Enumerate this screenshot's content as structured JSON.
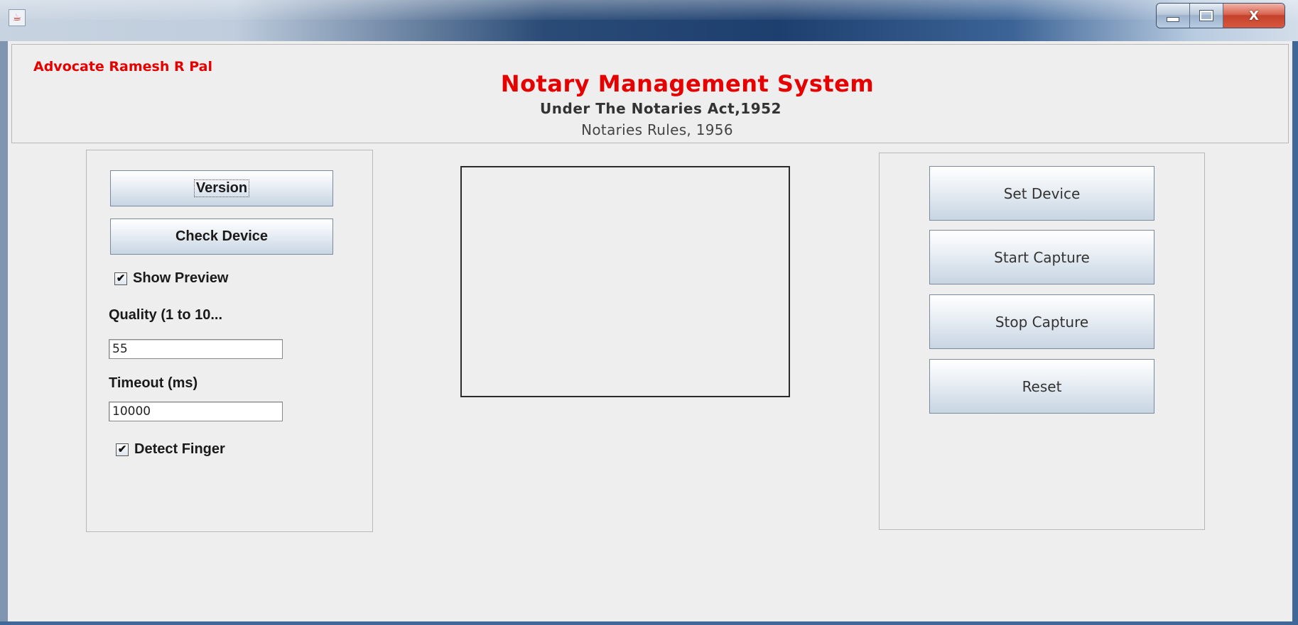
{
  "window": {
    "app_icon": "java-cup-icon",
    "controls": {
      "minimize_icon": "minimize-icon",
      "maximize_icon": "maximize-icon",
      "close_icon": "close-icon",
      "close_glyph": "X"
    }
  },
  "header": {
    "advocate": "Advocate Ramesh R Pal",
    "title": "Notary Management System",
    "subtitle": "Under The Notaries Act,1952",
    "rules": "Notaries Rules, 1956"
  },
  "left_panel": {
    "version_button": "Version",
    "check_device_button": "Check Device",
    "show_preview": {
      "label": "Show Preview",
      "checked": true
    },
    "quality_label": "Quality (1 to 10...",
    "quality_value": "55",
    "timeout_label": "Timeout (ms)",
    "timeout_value": "10000",
    "detect_finger": {
      "label": "Detect Finger",
      "checked": true
    }
  },
  "right_panel": {
    "set_device_button": "Set Device",
    "start_capture_button": "Start Capture",
    "stop_capture_button": "Stop Capture",
    "reset_button": "Reset"
  },
  "colors": {
    "title_red": "#e60000",
    "panel_bg": "#eeeeee"
  },
  "checkmark": "✔"
}
